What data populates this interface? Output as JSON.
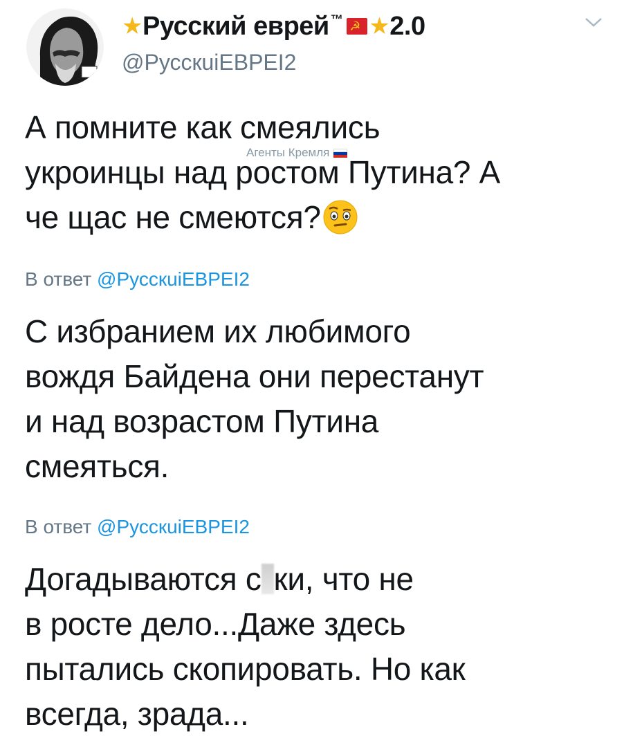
{
  "profile": {
    "display_name": "Русский еврей",
    "trademark": "™",
    "version": "2.0",
    "handle": "@РусскuiЕВРЕI2",
    "icons": [
      "star-icon",
      "soviet-flag-icon",
      "star-icon"
    ]
  },
  "kremlin_label": "Агенты Кремля",
  "tweet": {
    "lines": [
      "А помните как смеялись",
      "укроинцы над ростом Путина? А",
      "че щас не смеются?"
    ],
    "emoji": "face-with-raised-eyebrow"
  },
  "replies": [
    {
      "prefix": "В ответ ",
      "mention": "@РусскuiЕВРЕI2",
      "lines": [
        "С избранием их любимого",
        "вождя Байдена они перестанут",
        "и над возрастом Путина",
        "смеяться."
      ]
    },
    {
      "prefix": "В ответ ",
      "mention": "@РусскuiЕВРЕI2",
      "line1_before": "Догадываются с",
      "line1_after": "ки, что не",
      "lines": [
        "в росте дело...Даже здесь",
        "пытались скопировать. Но как",
        "всегда, зрада..."
      ]
    }
  ],
  "colors": {
    "text": "#14171a",
    "muted": "#657786",
    "link": "#1b95e0",
    "star": "#f5b81c"
  }
}
